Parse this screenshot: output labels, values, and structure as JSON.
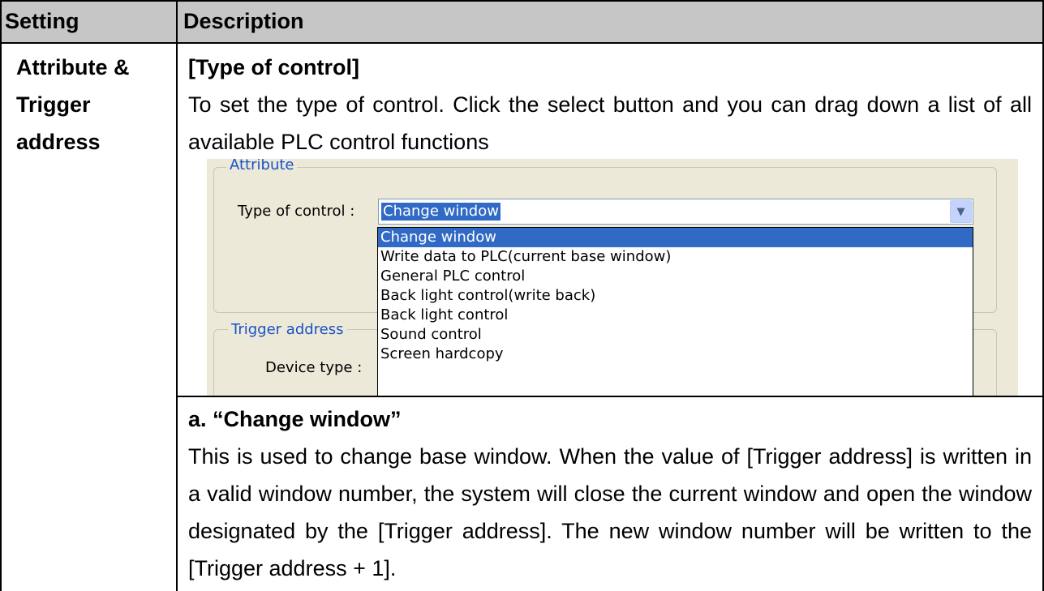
{
  "table": {
    "header": {
      "setting": "Setting",
      "description": "Description"
    },
    "row": {
      "setting_lines": [
        "Attribute &",
        "Trigger",
        "address"
      ],
      "section_title": "[Type of control]",
      "section_body": "To set the type of control. Click the select button and you can drag down a list of all available PLC control functions",
      "screenshot": {
        "attribute_group_title": "Attribute",
        "type_of_control_label": "Type of control :",
        "type_of_control_value": "Change window",
        "dropdown_options": [
          "Change window",
          "Write data to PLC(current base window)",
          "General PLC control",
          "Back light control(write back)",
          "Back light control",
          "Sound control",
          "Screen hardcopy"
        ],
        "selected_option_index": 0,
        "trigger_group_title": "Trigger address",
        "device_type_label": "Device type :"
      },
      "subsection_title": "a. “Change window”",
      "subsection_body": "This is used to change base window. When the value of [Trigger address] is written in a valid window number, the system will close the current window and open the window designated by the [Trigger address]. The new window number will be written to the [Trigger address + 1]."
    }
  },
  "colors": {
    "header_bg": "#c6c6c6",
    "selection": "#316ac5",
    "group_title": "#1852c7",
    "dialog_bg": "#ece9d8"
  }
}
